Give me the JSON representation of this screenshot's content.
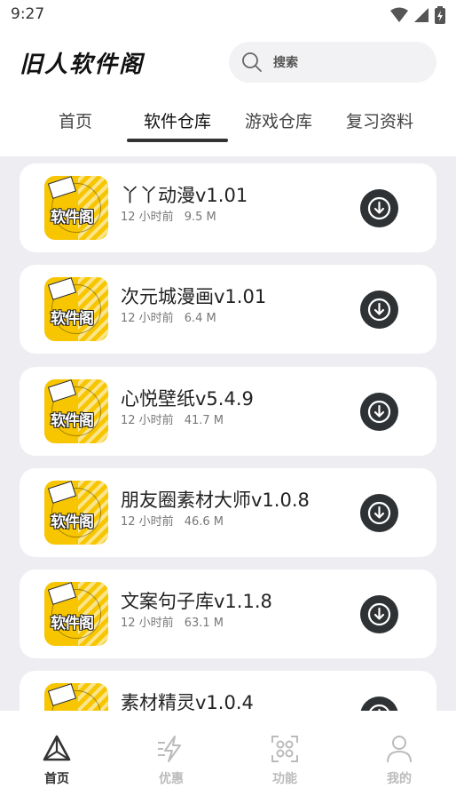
{
  "status_bar": {
    "time": "9:27"
  },
  "header": {
    "logo": "旧人软件阁",
    "search_placeholder": "搜索"
  },
  "tabs": [
    {
      "label": "首页"
    },
    {
      "label": "软件仓库"
    },
    {
      "label": "游戏仓库"
    },
    {
      "label": "复习资料"
    }
  ],
  "active_tab": "软件仓库",
  "app_icon_text": "软件阁",
  "apps": [
    {
      "title": "丫丫动漫v1.01",
      "time": "12 小时前",
      "size": "9.5 M"
    },
    {
      "title": "次元城漫画v1.01",
      "time": "12 小时前",
      "size": "6.4 M"
    },
    {
      "title": "心悦壁纸v5.4.9",
      "time": "12 小时前",
      "size": "41.7 M"
    },
    {
      "title": "朋友圈素材大师v1.0.8",
      "time": "12 小时前",
      "size": "46.6 M"
    },
    {
      "title": "文案句子库v1.1.8",
      "time": "12 小时前",
      "size": "63.1 M"
    },
    {
      "title": "素材精灵v1.0.4",
      "time": "",
      "size": ""
    }
  ],
  "bottom_nav": [
    {
      "label": "首页",
      "icon": "triangle-home-icon"
    },
    {
      "label": "优惠",
      "icon": "lightning-icon"
    },
    {
      "label": "功能",
      "icon": "grid-circles-icon"
    },
    {
      "label": "我的",
      "icon": "person-icon"
    }
  ],
  "colors": {
    "accent_dark": "#2f3234",
    "icon_yellow": "#f7c600",
    "list_bg": "#eeeef2"
  }
}
